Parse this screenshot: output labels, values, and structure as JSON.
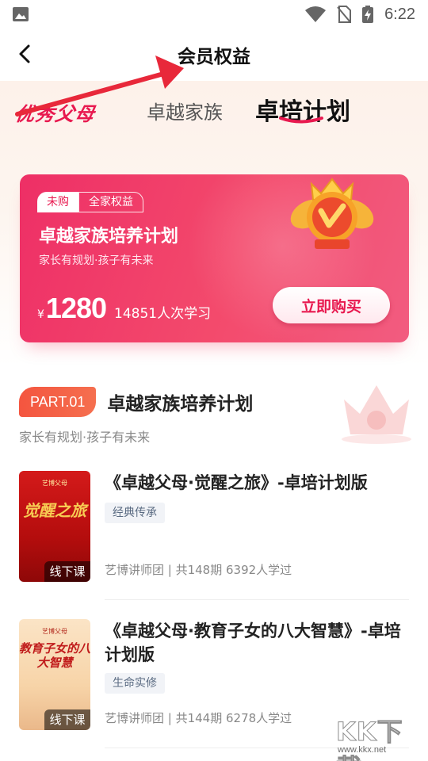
{
  "status_bar": {
    "time": "6:22"
  },
  "header": {
    "title": "会员权益"
  },
  "tabs": [
    {
      "label": "优秀父母"
    },
    {
      "label": "卓越家族"
    },
    {
      "label": "卓培计划",
      "active": true
    }
  ],
  "promo": {
    "badge_status": "未购",
    "badge_scope": "全家权益",
    "title": "卓越家族培养计划",
    "subtitle": "家长有规划·孩子有未来",
    "currency": "¥",
    "price": "1280",
    "learners": "14851人次学习",
    "buy_label": "立即购买"
  },
  "section": {
    "part": "PART.01",
    "title": "卓越家族培养计划",
    "subtitle": "家长有规划·孩子有未来"
  },
  "courses": [
    {
      "title": "《卓越父母·觉醒之旅》-卓培计划版",
      "badge": "经典传承",
      "meta": "艺博讲师团 | 共148期   6392人学过",
      "thumb_tag": "线下课",
      "thumb_logo": "艺博父母",
      "thumb_text": "觉醒之旅"
    },
    {
      "title": "《卓越父母·教育子女的八大智慧》-卓培计划版",
      "badge": "生命实修",
      "meta": "艺博讲师团 | 共144期   6278人学过",
      "thumb_tag": "线下课",
      "thumb_logo": "艺博父母",
      "thumb_text": "教育子女的八大智慧"
    }
  ],
  "watermark": {
    "brand": "KK下载",
    "url": "www.kkx.net"
  },
  "colors": {
    "accent": "#e8194f",
    "part_tag": "#f4553f"
  }
}
